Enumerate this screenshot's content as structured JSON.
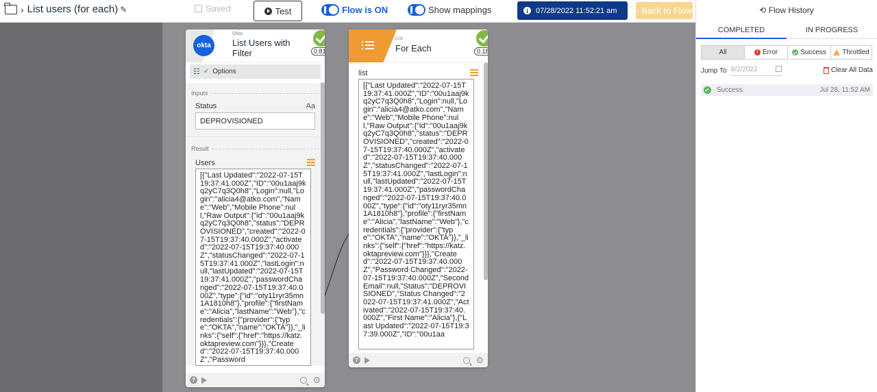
{
  "header": {
    "flow_name": "List users (for each)",
    "saved_label": "Saved",
    "test_label": "Test",
    "flow_status_label": "Flow is ON",
    "mappings_label": "Show mappings",
    "execution_timestamp": "07/28/2022 11:52:21 am",
    "back_label": "Back to Flow"
  },
  "card_okta": {
    "app_label": "Okta",
    "title": "List Users with Filter",
    "duration": "0.813s",
    "options_label": "Options",
    "inputs_label": "Inputs",
    "status_field_label": "Status",
    "status_type": "Aa",
    "status_value": "DEPROVISIONED",
    "result_label": "Result",
    "users_field_label": "Users",
    "users_json": "[{\"Last Updated\":\"2022-07-15T19:37:41.000Z\",\"ID\":\"00u1aaj9kq2yC7q3Q0h8\",\"Login\":null,\"Login\":\"alicia4@atko.com\",\"Name\":\"Web\",\"Mobile Phone\":null,\"Raw Output\":{\"id\":\"00u1aaj9kq2yC7q3Q0h8\",\"status\":\"DEPROVISIONED\",\"created\":\"2022-07-15T19:37:40.000Z\",\"activated\":\"2022-07-15T19:37:40.000Z\",\"statusChanged\":\"2022-07-15T19:37:41.000Z\",\"lastLogin\":null,\"lastUpdated\":\"2022-07-15T19:37:41.000Z\",\"passwordChanged\":\"2022-07-15T19:37:40.000Z\",\"type\":{\"id\":\"oty11ryr35mn1A1810h8\"},\"profile\":{\"firstName\":\"Alicia\",\"lastName\":\"Web\"},\"credentials\":{\"provider\":{\"type\":\"OKTA\",\"name\":\"OKTA\"}},\"_links\":{\"self\":{\"href\":\"https://katz.oktapreview.com\"}}},\"Created\":\"2022-07-15T19:37:40.000Z\",\"Password"
  },
  "card_each": {
    "app_label": "List",
    "title": "For Each",
    "duration": "0.187s",
    "list_field_label": "list",
    "list_json": "[{\"Last Updated\":\"2022-07-15T19:37:41.000Z\",\"ID\":\"00u1aaj9kq2yC7q3Q0h8\",\"Login\":null,\"Login\":\"alicia4@atko.com\",\"Name\":\"Web\",\"Mobile Phone\":null,\"Raw Output\":{\"id\":\"00u1aaj9kq2yC7q3Q0h8\",\"status\":\"DEPROVISIONED\",\"created\":\"2022-07-15T19:37:40.000Z\",\"activated\":\"2022-07-15T19:37:40.000Z\",\"statusChanged\":\"2022-07-15T19:37:41.000Z\",\"lastLogin\":null,\"lastUpdated\":\"2022-07-15T19:37:41.000Z\",\"passwordChanged\":\"2022-07-15T19:37:40.000Z\",\"type\":{\"id\":\"oty11ryr35mn1A1810h8\"},\"profile\":{\"firstName\":\"Alicia\",\"lastName\":\"Web\"},\"credentials\":{\"provider\":{\"type\":\"OKTA\",\"name\":\"OKTA\"}},\"_links\":{\"self\":{\"href\":\"https://katz.oktapreview.com\"}}},\"Created\":\"2022-07-15T19:37:40.000Z\",\"Password Changed\":\"2022-07-15T19:37:40.000Z\",\"Second Email\":null,\"Status\":\"DEPROVISIONED\",\"Status Changed\":\"2022-07-15T19:37:41.000Z\",\"Activated\":\"2022-07-15T19:37:40.000Z\",\"First Name\":\"Alicia\"},{\"Last Updated\":\"2022-07-15T19:37:39.000Z\",\"ID\":\"00u1aa"
  },
  "history": {
    "title": "Flow History",
    "tabs": [
      "COMPLETED",
      "IN PROGRESS"
    ],
    "filters": [
      "All",
      "Error",
      "Success",
      "Throttled"
    ],
    "jump_label": "Jump To",
    "jump_placeholder": "8/2/2022",
    "clear_label": "Clear All Data",
    "rows": [
      {
        "status": "Success",
        "time": "Jul 28, 11:52 AM"
      }
    ]
  },
  "colors": {
    "accent": "#1662dd",
    "header_badge": "#0e3a86",
    "success": "#7fba43",
    "list_orange": "#ef9a32",
    "canvas": "#8d8d91"
  }
}
